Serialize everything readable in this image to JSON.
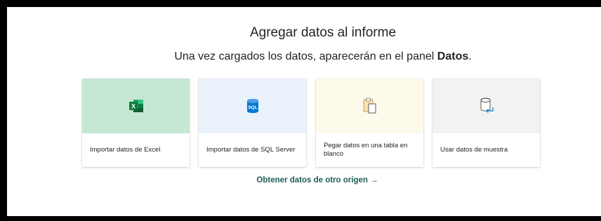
{
  "dialog": {
    "title": "Agregar datos al informe",
    "subtitle_prefix": "Una vez cargados los datos, aparecerán en el panel ",
    "subtitle_strong": "Datos",
    "subtitle_suffix": "."
  },
  "cards": [
    {
      "label": "Importar datos de Excel",
      "icon": "excel-icon",
      "hero_color": "#c6e8d3"
    },
    {
      "label": "Importar datos de SQL Server",
      "icon": "sql-server-icon",
      "hero_color": "#eaf3fc"
    },
    {
      "label": "Pegar datos en una tabla en blanco",
      "icon": "paste-icon",
      "hero_color": "#fefaeb"
    },
    {
      "label": "Usar datos de muestra",
      "icon": "sample-data-icon",
      "hero_color": "#f3f2f1"
    }
  ],
  "sql_icon_text": "SQL",
  "excel_icon_text": "X",
  "other_source_link": "Obtener datos de otro origen →"
}
